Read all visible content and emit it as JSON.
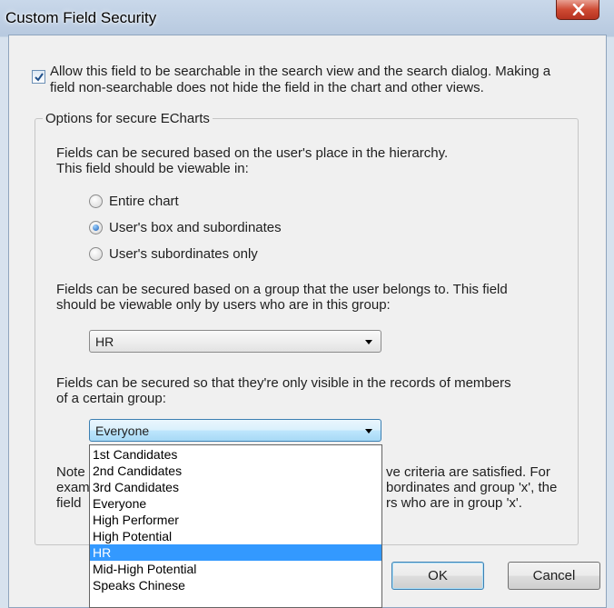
{
  "window": {
    "title": "Custom Field Security"
  },
  "searchable": {
    "checked": true,
    "line1": "Allow this field to be searchable in the search view and the search dialog. Making a",
    "line2": "field non-searchable does not hide the field in the chart and other views."
  },
  "secure": {
    "legend": "Options for secure ECharts",
    "hierarchy": {
      "line1": "Fields can be secured based on the user's place in the hierarchy.",
      "line2": "This field should be viewable in:",
      "options": [
        {
          "label": "Entire chart",
          "selected": false
        },
        {
          "label": "User's box and subordinates",
          "selected": true
        },
        {
          "label": "User's subordinates only",
          "selected": false
        }
      ]
    },
    "group": {
      "line1": "Fields can be secured based on a group that the user belongs to. This field",
      "line2": "should be viewable only by users who are in this group:",
      "value": "HR"
    },
    "members": {
      "line1": "Fields can be secured so that they're only visible in the records of members",
      "line2": "of a certain group:",
      "value": "Everyone",
      "options": [
        "1st Candidates",
        "2nd Candidates",
        "3rd Candidates",
        "Everyone",
        "High Performer",
        "High Potential",
        "HR",
        "Mid-High Potential",
        "Speaks Chinese"
      ],
      "highlighted": "HR"
    },
    "note": {
      "left1": "Note",
      "left2": "exam",
      "left3": "field",
      "right1": "ve criteria are satisfied. For",
      "right2": "bordinates and group 'x', the",
      "right3": "rs who are in group 'x'."
    }
  },
  "buttons": {
    "ok": "OK",
    "cancel": "Cancel"
  }
}
